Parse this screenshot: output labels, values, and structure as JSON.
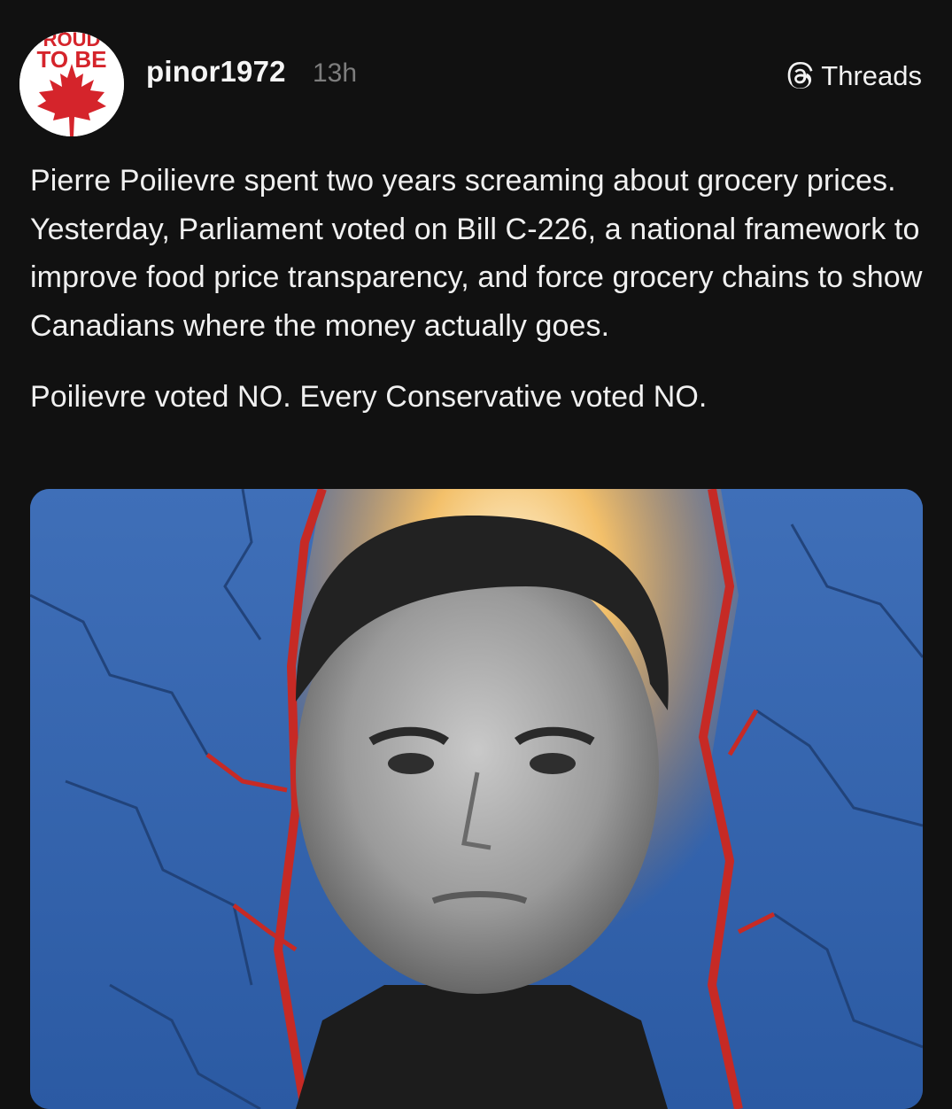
{
  "post": {
    "avatar": {
      "logo_text_top": "ROUD",
      "logo_text_bottom": "TO BE",
      "icon": "maple-leaf-icon",
      "colors": {
        "brand_red": "#d5242b",
        "background": "#ffffff"
      }
    },
    "username": "pinor1972",
    "timestamp": "13h",
    "platform_label": "Threads",
    "platform_icon": "threads-logo-icon",
    "paragraphs": [
      "Pierre Poilievre spent two years screaming about grocery prices. Yesterday, Parliament voted on Bill C-226, a national framework to improve food price transparency, and force grocery chains to show Canadians where the money actually goes.",
      "Poilievre voted NO. Every Conservative voted NO."
    ],
    "media": {
      "type": "image",
      "colors": {
        "wall": "#3b6bb5",
        "crack": "#c62a25",
        "glow": "#f5c46a"
      }
    }
  },
  "colors": {
    "background": "#111111",
    "text": "#f0f0f0",
    "muted": "#7d7d7d"
  }
}
